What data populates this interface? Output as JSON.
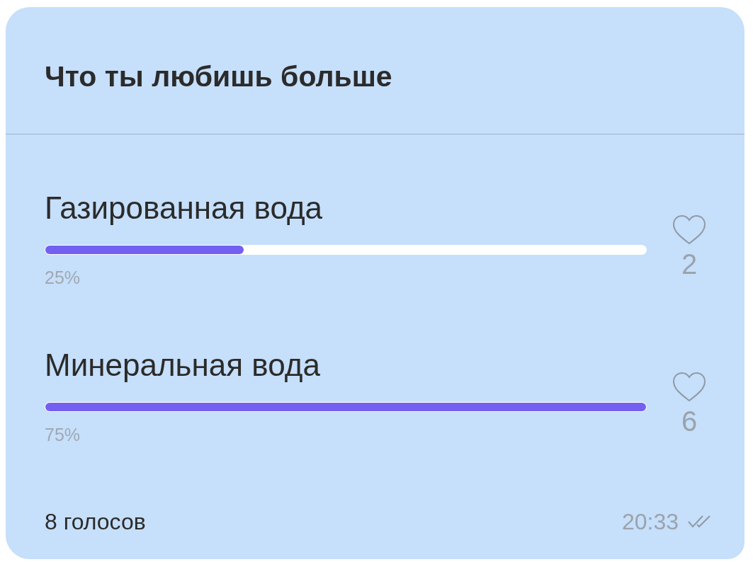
{
  "poll": {
    "question": "Что ты любишь больше",
    "options": [
      {
        "label": "Газированная вода",
        "level": 0.33,
        "percent": "25%",
        "likes": "2"
      },
      {
        "label": "Минеральная вода",
        "level": 1.0,
        "percent": "75%",
        "likes": "6"
      }
    ],
    "total_votes": "8 голосов",
    "time": "20:33"
  }
}
